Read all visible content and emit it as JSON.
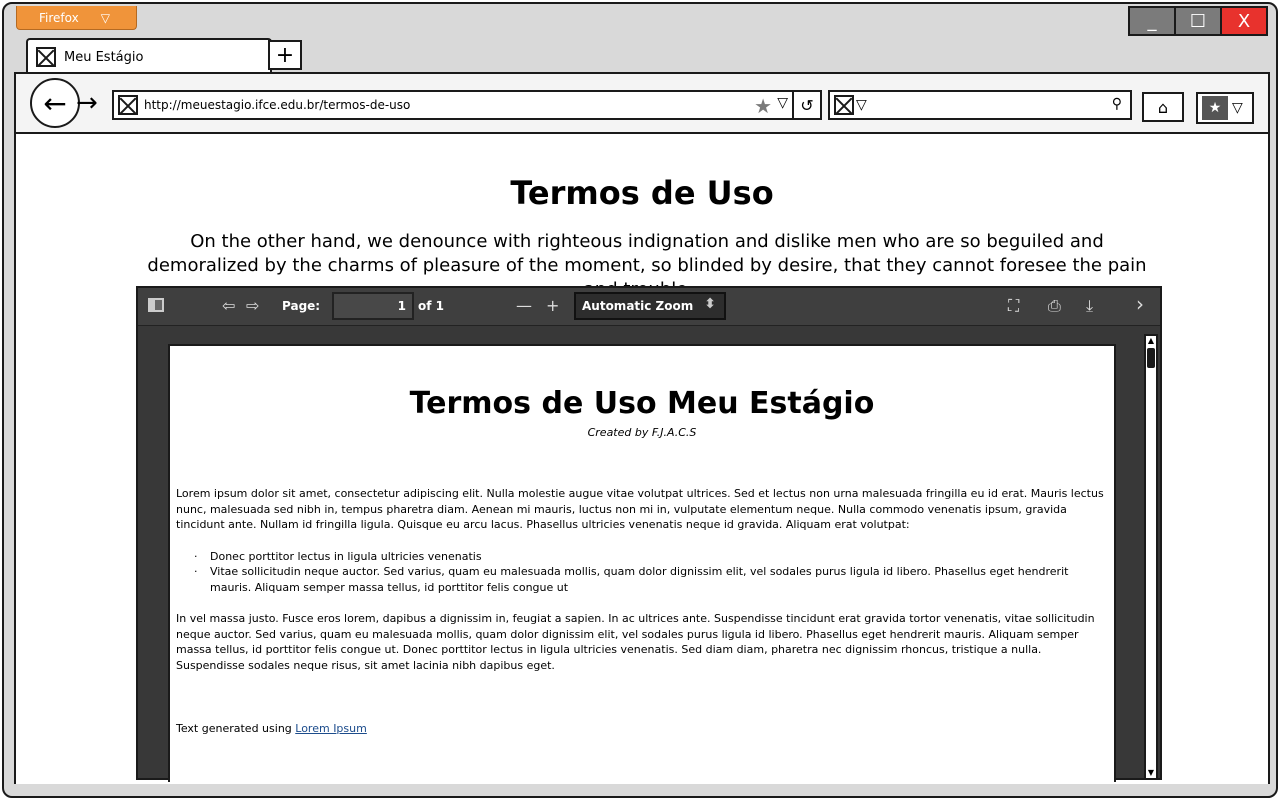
{
  "browser": {
    "app_button_label": "Firefox",
    "app_button_caret": "▽",
    "tab_title": "Meu Estágio",
    "new_tab_label": "+",
    "url": "http://meuestagio.ifce.edu.br/termos-de-uso",
    "window_controls": {
      "minimize": "_",
      "maximize": "☐",
      "close": "X"
    }
  },
  "page": {
    "title": "Termos de Uso",
    "intro": "On the other hand, we denounce with righteous indignation and dislike men who are so beguiled and demoralized by the charms of pleasure of the moment, so blinded by desire, that they cannot foresee the pain and trouble...."
  },
  "pdf_viewer": {
    "page_label": "Page:",
    "page_value": "1",
    "page_count": "of 1",
    "zoom_value": "Automatic Zoom"
  },
  "document": {
    "title": "Termos de Uso Meu Estágio",
    "subtitle": "Created by F.J.A.C.S",
    "paragraph_1": "Lorem ipsum dolor sit amet, consectetur adipiscing elit. Nulla molestie augue vitae volutpat ultrices. Sed et lectus non urna malesuada fringilla eu id erat. Mauris lectus nunc, malesuada sed nibh in, tempus pharetra diam. Aenean mi mauris, luctus non mi in, vulputate elementum neque. Nulla commodo venenatis ipsum, gravida tincidunt ante. Nullam id fringilla ligula. Quisque eu arcu lacus. Phasellus ultricies venenatis neque id gravida. Aliquam erat volutpat:",
    "list": [
      "Donec porttitor lectus in ligula ultricies venenatis",
      "Vitae sollicitudin neque auctor. Sed varius, quam eu malesuada mollis, quam dolor dignissim elit, vel sodales purus ligula id libero. Phasellus eget hendrerit mauris. Aliquam semper massa tellus, id porttitor felis congue ut"
    ],
    "paragraph_2": "In vel massa justo. Fusce eros lorem, dapibus a dignissim in, feugiat a sapien. In ac ultrices ante. Suspendisse tincidunt erat gravida tortor venenatis, vitae sollicitudin neque auctor. Sed varius, quam eu malesuada mollis, quam dolor dignissim elit, vel sodales purus ligula id libero. Phasellus eget hendrerit mauris. Aliquam semper massa tellus, id porttitor felis congue ut. Donec porttitor lectus in ligula ultricies venenatis. Sed diam diam, pharetra nec dignissim rhoncus, tristique a nulla. Suspendisse sodales neque risus, sit amet lacinia nibh dapibus eget.",
    "footer_text": "Text generated using ",
    "footer_link": "Lorem Ipsum"
  },
  "icons": {
    "back": "back-arrow-icon",
    "forward": "forward-arrow-icon",
    "bookmark_star": "star-icon",
    "reload": "reload-icon",
    "search": "magnifier-icon",
    "home": "home-icon",
    "bookmarks": "bookmarks-icon",
    "sidebar": "sidebar-toggle-icon",
    "prev_page": "arrow-up-icon",
    "next_page": "arrow-down-icon",
    "zoom_out": "minus-icon",
    "zoom_in": "plus-icon",
    "fullscreen": "presentation-mode-icon",
    "print": "print-icon",
    "download": "download-icon",
    "tools": "chevron-right-icon"
  },
  "colors": {
    "app_button": "#f0943a",
    "close_button": "#e8322d",
    "pdf_toolbar": "#3f3f3f",
    "link": "#1c4c8c"
  }
}
